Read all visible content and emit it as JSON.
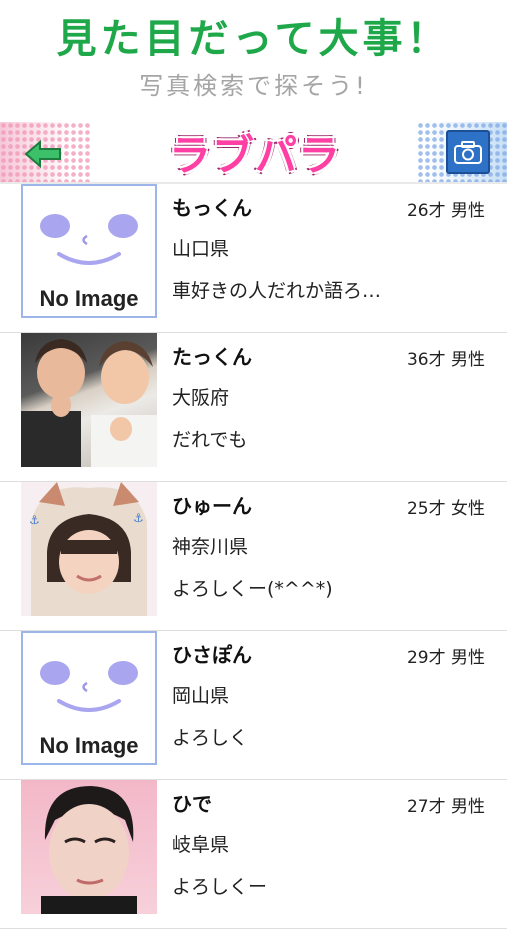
{
  "promo": {
    "headline": "見た目だって大事！",
    "subline": "写真検索で探そう!"
  },
  "header": {
    "logo": "ラブパラ",
    "back_icon": "back-arrow-icon",
    "camera_icon": "camera-icon"
  },
  "users": [
    {
      "name": "もっくん",
      "age_gender": "26才 男性",
      "prefecture": "山口県",
      "message": "車好きの人だれか語ろ…",
      "photo": "no-image",
      "no_image_label": "No Image"
    },
    {
      "name": "たっくん",
      "age_gender": "36才 男性",
      "prefecture": "大阪府",
      "message": "だれでも",
      "photo": "photo"
    },
    {
      "name": "ひゅーん",
      "age_gender": "25才 女性",
      "prefecture": "神奈川県",
      "message": "よろしくー(*^^*)",
      "photo": "photo"
    },
    {
      "name": "ひさぽん",
      "age_gender": "29才 男性",
      "prefecture": "岡山県",
      "message": "よろしく",
      "photo": "no-image",
      "no_image_label": "No Image"
    },
    {
      "name": "ひで",
      "age_gender": "27才 男性",
      "prefecture": "岐阜県",
      "message": "よろしくー",
      "photo": "photo"
    }
  ]
}
